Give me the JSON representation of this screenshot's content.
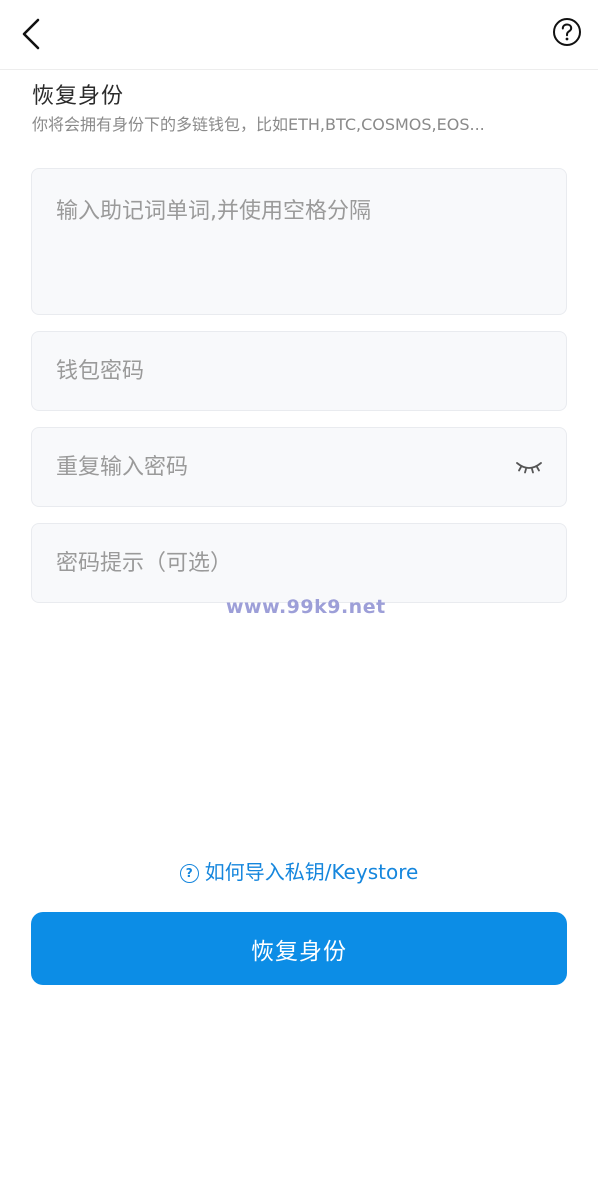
{
  "header": {
    "back_icon": "chevron-left-icon",
    "help_icon": "question-circle-icon"
  },
  "title": "恢复身份",
  "subtitle": "你将会拥有身份下的多链钱包，比如ETH,BTC,COSMOS,EOS...",
  "form": {
    "mnemonic_placeholder": "输入助记词单词,并使用空格分隔",
    "password_placeholder": "钱包密码",
    "repeat_password_placeholder": "重复输入密码",
    "password_hint_placeholder": "密码提示（可选）",
    "eye_icon": "eye-closed-icon"
  },
  "watermark": "www.99k9.net",
  "help_link": {
    "icon": "?",
    "label": "如何导入私钥/Keystore"
  },
  "submit": {
    "label": "恢复身份"
  },
  "colors": {
    "accent": "#0c8de6",
    "link": "#1586dd",
    "input_bg": "#f8f9fb",
    "watermark": "#9d9fd8"
  }
}
